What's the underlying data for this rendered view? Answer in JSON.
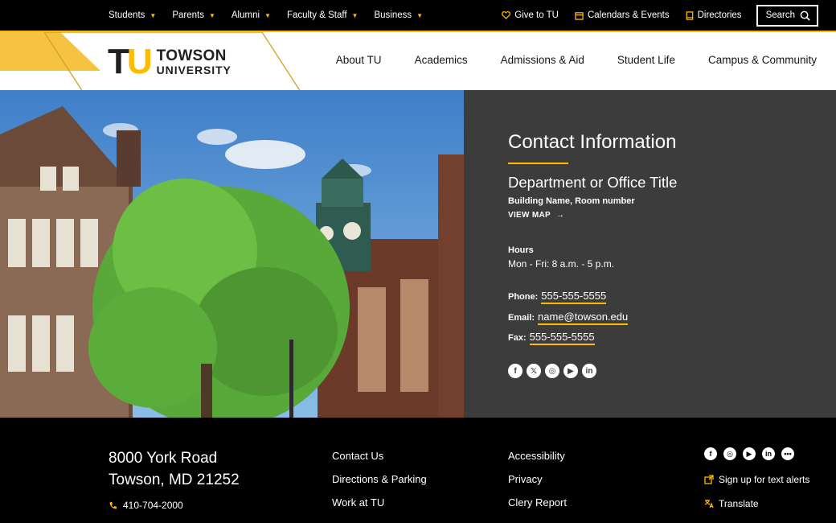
{
  "utility": {
    "left_items": [
      "Students",
      "Parents",
      "Alumni",
      "Faculty & Staff",
      "Business"
    ],
    "give": "Give to TU",
    "calendars": "Calendars & Events",
    "directories": "Directories",
    "search": "Search"
  },
  "logo": {
    "mark_t": "T",
    "mark_u": "U",
    "line1": "TOWSON",
    "line2": "UNIVERSITY"
  },
  "nav": [
    "About TU",
    "Academics",
    "Admissions & Aid",
    "Student Life",
    "Campus & Community"
  ],
  "contact": {
    "title": "Contact Information",
    "department": "Department or Office Title",
    "building": "Building Name, Room number",
    "view_map": "VIEW MAP",
    "hours_label": "Hours",
    "hours": "Mon - Fri: 8 a.m. - 5 p.m.",
    "phone_label": "Phone:",
    "phone": "555-555-5555",
    "email_label": "Email:",
    "email": "name@towson.edu",
    "fax_label": "Fax:",
    "fax": "555-555-5555",
    "socials": [
      "facebook-icon",
      "x-icon",
      "instagram-icon",
      "youtube-icon",
      "linkedin-icon"
    ]
  },
  "footer": {
    "address_line1": "8000 York Road",
    "address_line2": "Towson, MD 21252",
    "phone": "410-704-2000",
    "col1": [
      "Contact Us",
      "Directions & Parking",
      "Work at TU"
    ],
    "col2": [
      "Accessibility",
      "Privacy",
      "Clery Report"
    ],
    "text_alerts": "Sign up for text alerts",
    "translate": "Translate"
  },
  "colors": {
    "gold": "#ffbb00",
    "panel": "#3c3c3c",
    "black": "#000000"
  }
}
